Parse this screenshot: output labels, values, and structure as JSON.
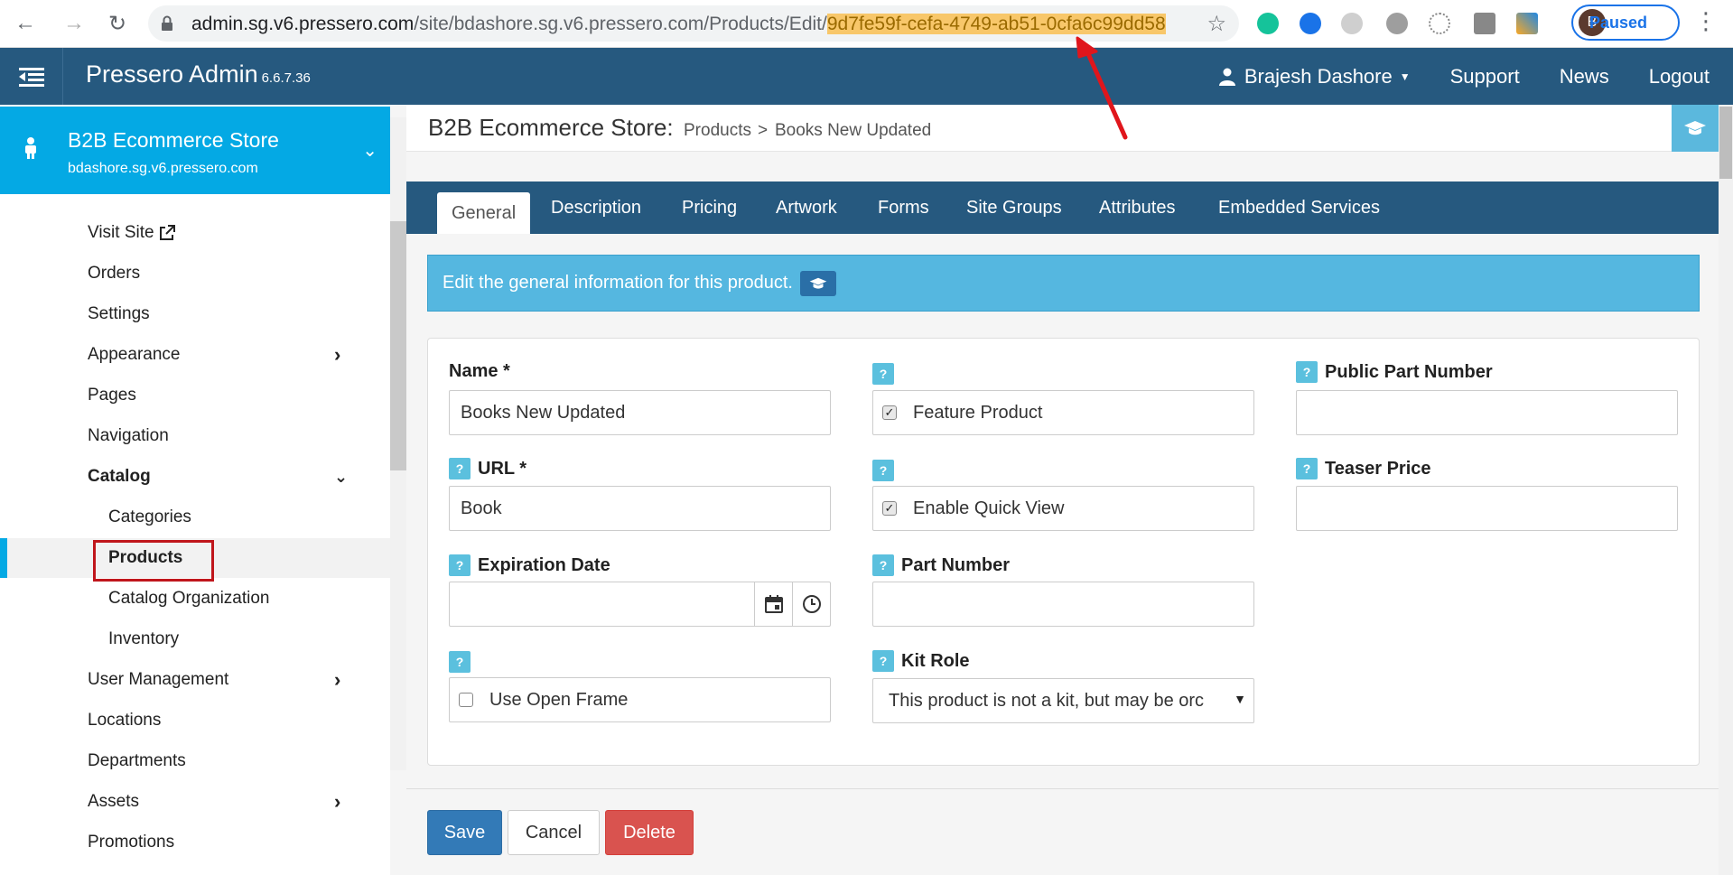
{
  "browser": {
    "url_host": "admin.sg.v6.pressero.com",
    "url_path": "/site/bdashore.sg.v6.pressero.com/Products/Edit/",
    "url_id": "9d7fe59f-cefa-4749-ab51-0cfa6c99dd58",
    "profile_initial": "B",
    "profile_status": "Paused"
  },
  "header": {
    "brand": "Pressero Admin",
    "version": "6.6.7.36",
    "user": "Brajesh Dashore",
    "support": "Support",
    "news": "News",
    "logout": "Logout"
  },
  "sidebar": {
    "store_name": "B2B Ecommerce Store",
    "store_host": "bdashore.sg.v6.pressero.com",
    "items": [
      {
        "label": "Visit Site"
      },
      {
        "label": "Orders"
      },
      {
        "label": "Settings"
      },
      {
        "label": "Appearance"
      },
      {
        "label": "Pages"
      },
      {
        "label": "Navigation"
      },
      {
        "label": "Catalog"
      },
      {
        "label": "Categories"
      },
      {
        "label": "Products"
      },
      {
        "label": "Catalog Organization"
      },
      {
        "label": "Inventory"
      },
      {
        "label": "User Management"
      },
      {
        "label": "Locations"
      },
      {
        "label": "Departments"
      },
      {
        "label": "Assets"
      },
      {
        "label": "Promotions"
      }
    ]
  },
  "page": {
    "title": "B2B Ecommerce Store:",
    "crumb_1": "Products",
    "crumb_sep": ">",
    "crumb_2": "Books New Updated"
  },
  "tabs": [
    "General",
    "Description",
    "Pricing",
    "Artwork",
    "Forms",
    "Site Groups",
    "Attributes",
    "Embedded Services"
  ],
  "info": "Edit the general information for this product.",
  "form": {
    "name_label": "Name *",
    "name_value": "Books New Updated",
    "url_label": "URL *",
    "url_value": "Book",
    "expiration_label": "Expiration Date",
    "expiration_value": "",
    "open_frame_label": "Use Open Frame",
    "feature_label": "Feature Product",
    "quick_view_label": "Enable Quick View",
    "part_number_label": "Part Number",
    "part_number_value": "",
    "kit_role_label": "Kit Role",
    "kit_role_value": "This product is not a kit, but may be orc",
    "public_part_label": "Public Part Number",
    "public_part_value": "",
    "teaser_label": "Teaser Price",
    "teaser_value": "",
    "help_mark": "?"
  },
  "buttons": {
    "save": "Save",
    "cancel": "Cancel",
    "delete": "Delete"
  },
  "colors": {
    "header_bg": "#26597f",
    "store_card": "#04a9e4",
    "info_bg": "#55b7e0",
    "save": "#337ab7",
    "delete": "#d9534f",
    "url_highlight": "#f8c76a",
    "annotation": "#e0161c"
  }
}
